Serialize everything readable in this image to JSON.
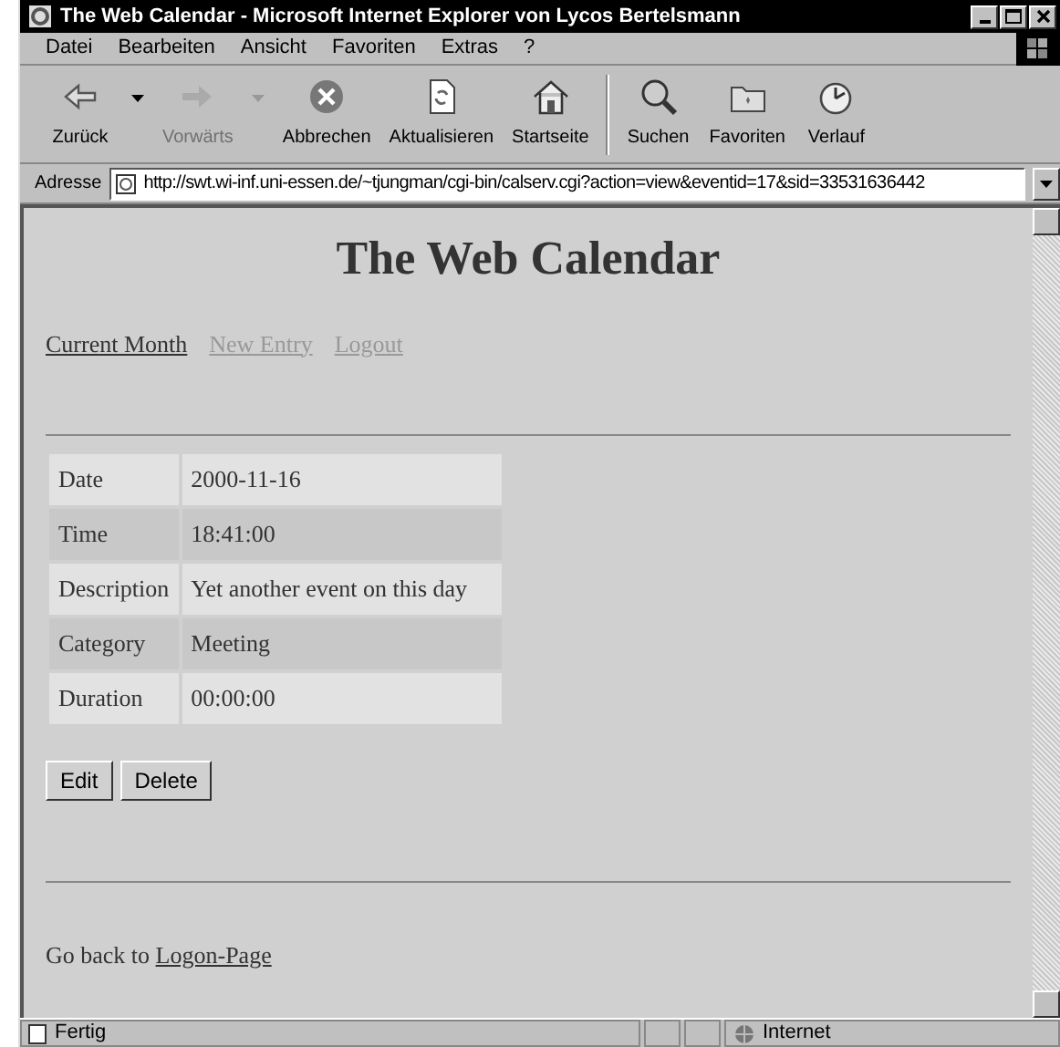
{
  "window": {
    "title": "The Web Calendar - Microsoft Internet Explorer von Lycos Bertelsmann"
  },
  "menu": [
    "Datei",
    "Bearbeiten",
    "Ansicht",
    "Favoriten",
    "Extras",
    "?"
  ],
  "toolbar": [
    {
      "kind": "back",
      "label": "Zurück",
      "disabled": false,
      "dropdown": true
    },
    {
      "kind": "forward",
      "label": "Vorwärts",
      "disabled": true,
      "dropdown": true
    },
    {
      "kind": "stop",
      "label": "Abbrechen",
      "disabled": false,
      "dropdown": false
    },
    {
      "kind": "refresh",
      "label": "Aktualisieren",
      "disabled": false,
      "dropdown": false
    },
    {
      "kind": "home",
      "label": "Startseite",
      "disabled": false,
      "dropdown": false
    },
    {
      "kind": "search",
      "label": "Suchen",
      "disabled": false,
      "dropdown": false
    },
    {
      "kind": "favorites",
      "label": "Favoriten",
      "disabled": false,
      "dropdown": false
    },
    {
      "kind": "history",
      "label": "Verlauf",
      "disabled": false,
      "dropdown": false
    }
  ],
  "address": {
    "label": "Adresse",
    "value": "http://swt.wi-inf.uni-essen.de/~tjungman/cgi-bin/calserv.cgi?action=view&eventid=17&sid=33531636442"
  },
  "page": {
    "heading": "The Web Calendar",
    "nav_links": [
      {
        "label": "Current Month",
        "visited": true
      },
      {
        "label": "New Entry",
        "visited": false
      },
      {
        "label": "Logout",
        "visited": false
      }
    ],
    "details": [
      {
        "label": "Date",
        "value": "2000-11-16"
      },
      {
        "label": "Time",
        "value": "18:41:00"
      },
      {
        "label": "Description",
        "value": "Yet another event on this day"
      },
      {
        "label": "Category",
        "value": "Meeting"
      },
      {
        "label": "Duration",
        "value": "00:00:00"
      }
    ],
    "buttons": [
      "Edit",
      "Delete"
    ],
    "footer_text": "Go back to",
    "footer_link": "Logon-Page"
  },
  "status_bar": {
    "text": "Fertig",
    "zone": "Internet"
  }
}
